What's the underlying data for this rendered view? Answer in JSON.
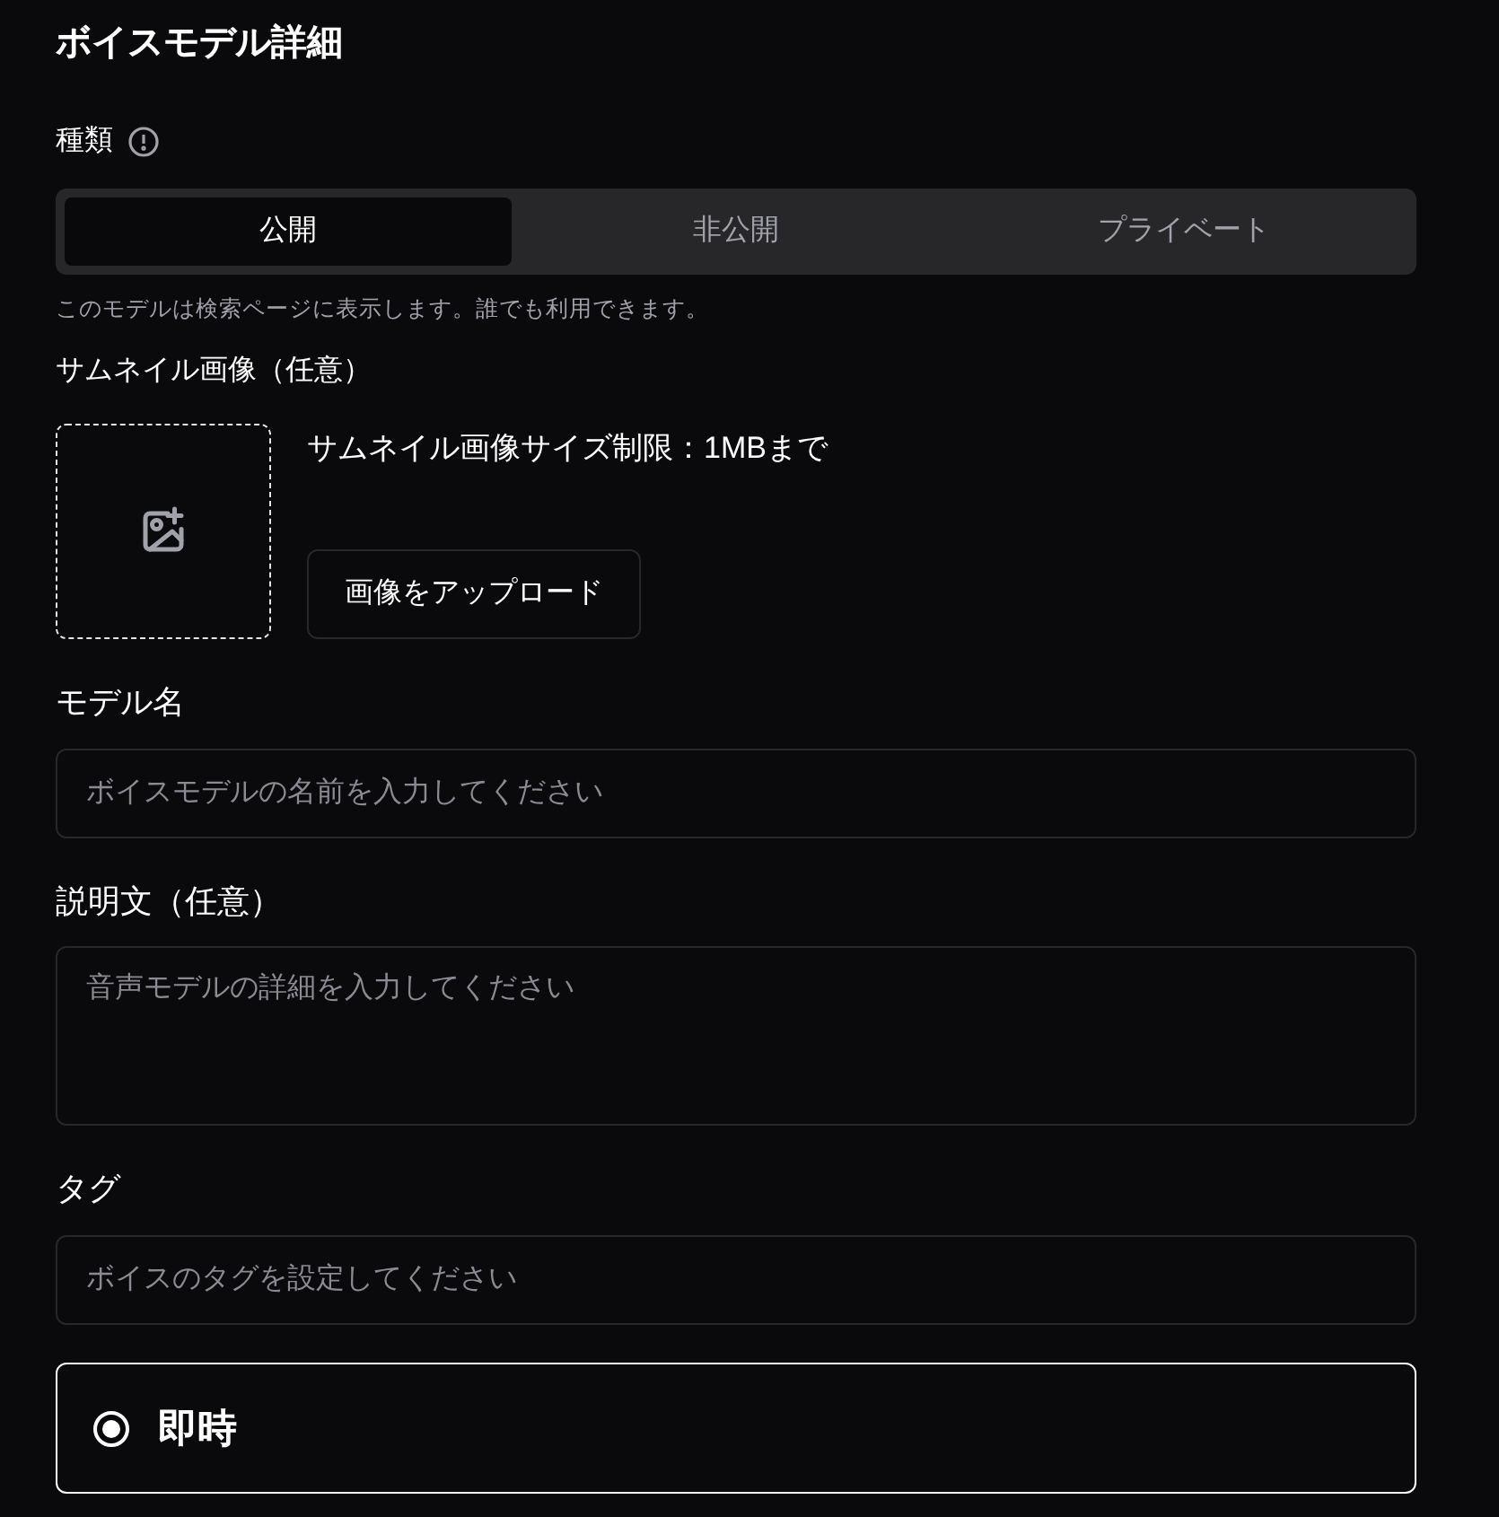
{
  "title": "ボイスモデル詳細",
  "visibility": {
    "label": "種類",
    "tabs": [
      {
        "label": "公開",
        "selected": true
      },
      {
        "label": "非公開",
        "selected": false
      },
      {
        "label": "プライベート",
        "selected": false
      }
    ],
    "help": "このモデルは検索ページに表示します。誰でも利用できます。"
  },
  "thumbnail": {
    "label": "サムネイル画像（任意）",
    "limit": "サムネイル画像サイズ制限：1MBまで",
    "upload_button": "画像をアップロード"
  },
  "fields": [
    {
      "label": "モデル名",
      "placeholder": "ボイスモデルの名前を入力してください",
      "kind": "input"
    },
    {
      "label": "説明文（任意）",
      "placeholder": "音声モデルの詳細を入力してください",
      "kind": "textarea"
    },
    {
      "label": "タグ",
      "placeholder": "ボイスのタグを設定してください",
      "kind": "input"
    }
  ],
  "publish_options": [
    {
      "label": "即時",
      "selected": true
    }
  ]
}
